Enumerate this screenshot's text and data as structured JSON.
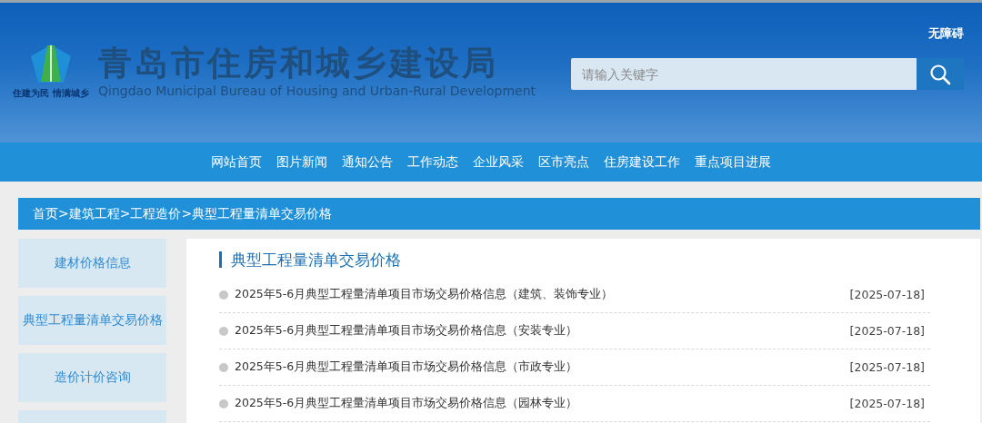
{
  "header": {
    "logo_tagline": "住建为民 情满城乡",
    "title": "青岛市住房和城乡建设局",
    "subtitle": "Qingdao Municipal Bureau of Housing and Urban-Rural Development",
    "accessibility_link": "无障碍",
    "search": {
      "placeholder": "请输入关键字"
    }
  },
  "nav": [
    "网站首页",
    "图片新闻",
    "通知公告",
    "工作动态",
    "企业风采",
    "区市亮点",
    "住房建设工作",
    "重点项目进展"
  ],
  "breadcrumb": "首页>建筑工程>工程造价>典型工程量清单交易价格",
  "sidebar": {
    "items": [
      {
        "label": "建材价格信息"
      },
      {
        "label": "典型工程量清单交易价格"
      },
      {
        "label": "造价计价咨询"
      }
    ]
  },
  "main": {
    "heading": "典型工程量清单交易价格",
    "articles": [
      {
        "title": "2025年5-6月典型工程量清单项目市场交易价格信息（建筑、装饰专业）",
        "date": "[2025-07-18]"
      },
      {
        "title": "2025年5-6月典型工程量清单项目市场交易价格信息（安装专业）",
        "date": "[2025-07-18]"
      },
      {
        "title": "2025年5-6月典型工程量清单项目市场交易价格信息（市政专业）",
        "date": "[2025-07-18]"
      },
      {
        "title": "2025年5-6月典型工程量清单项目市场交易价格信息（园林专业）",
        "date": "[2025-07-18]"
      }
    ]
  }
}
